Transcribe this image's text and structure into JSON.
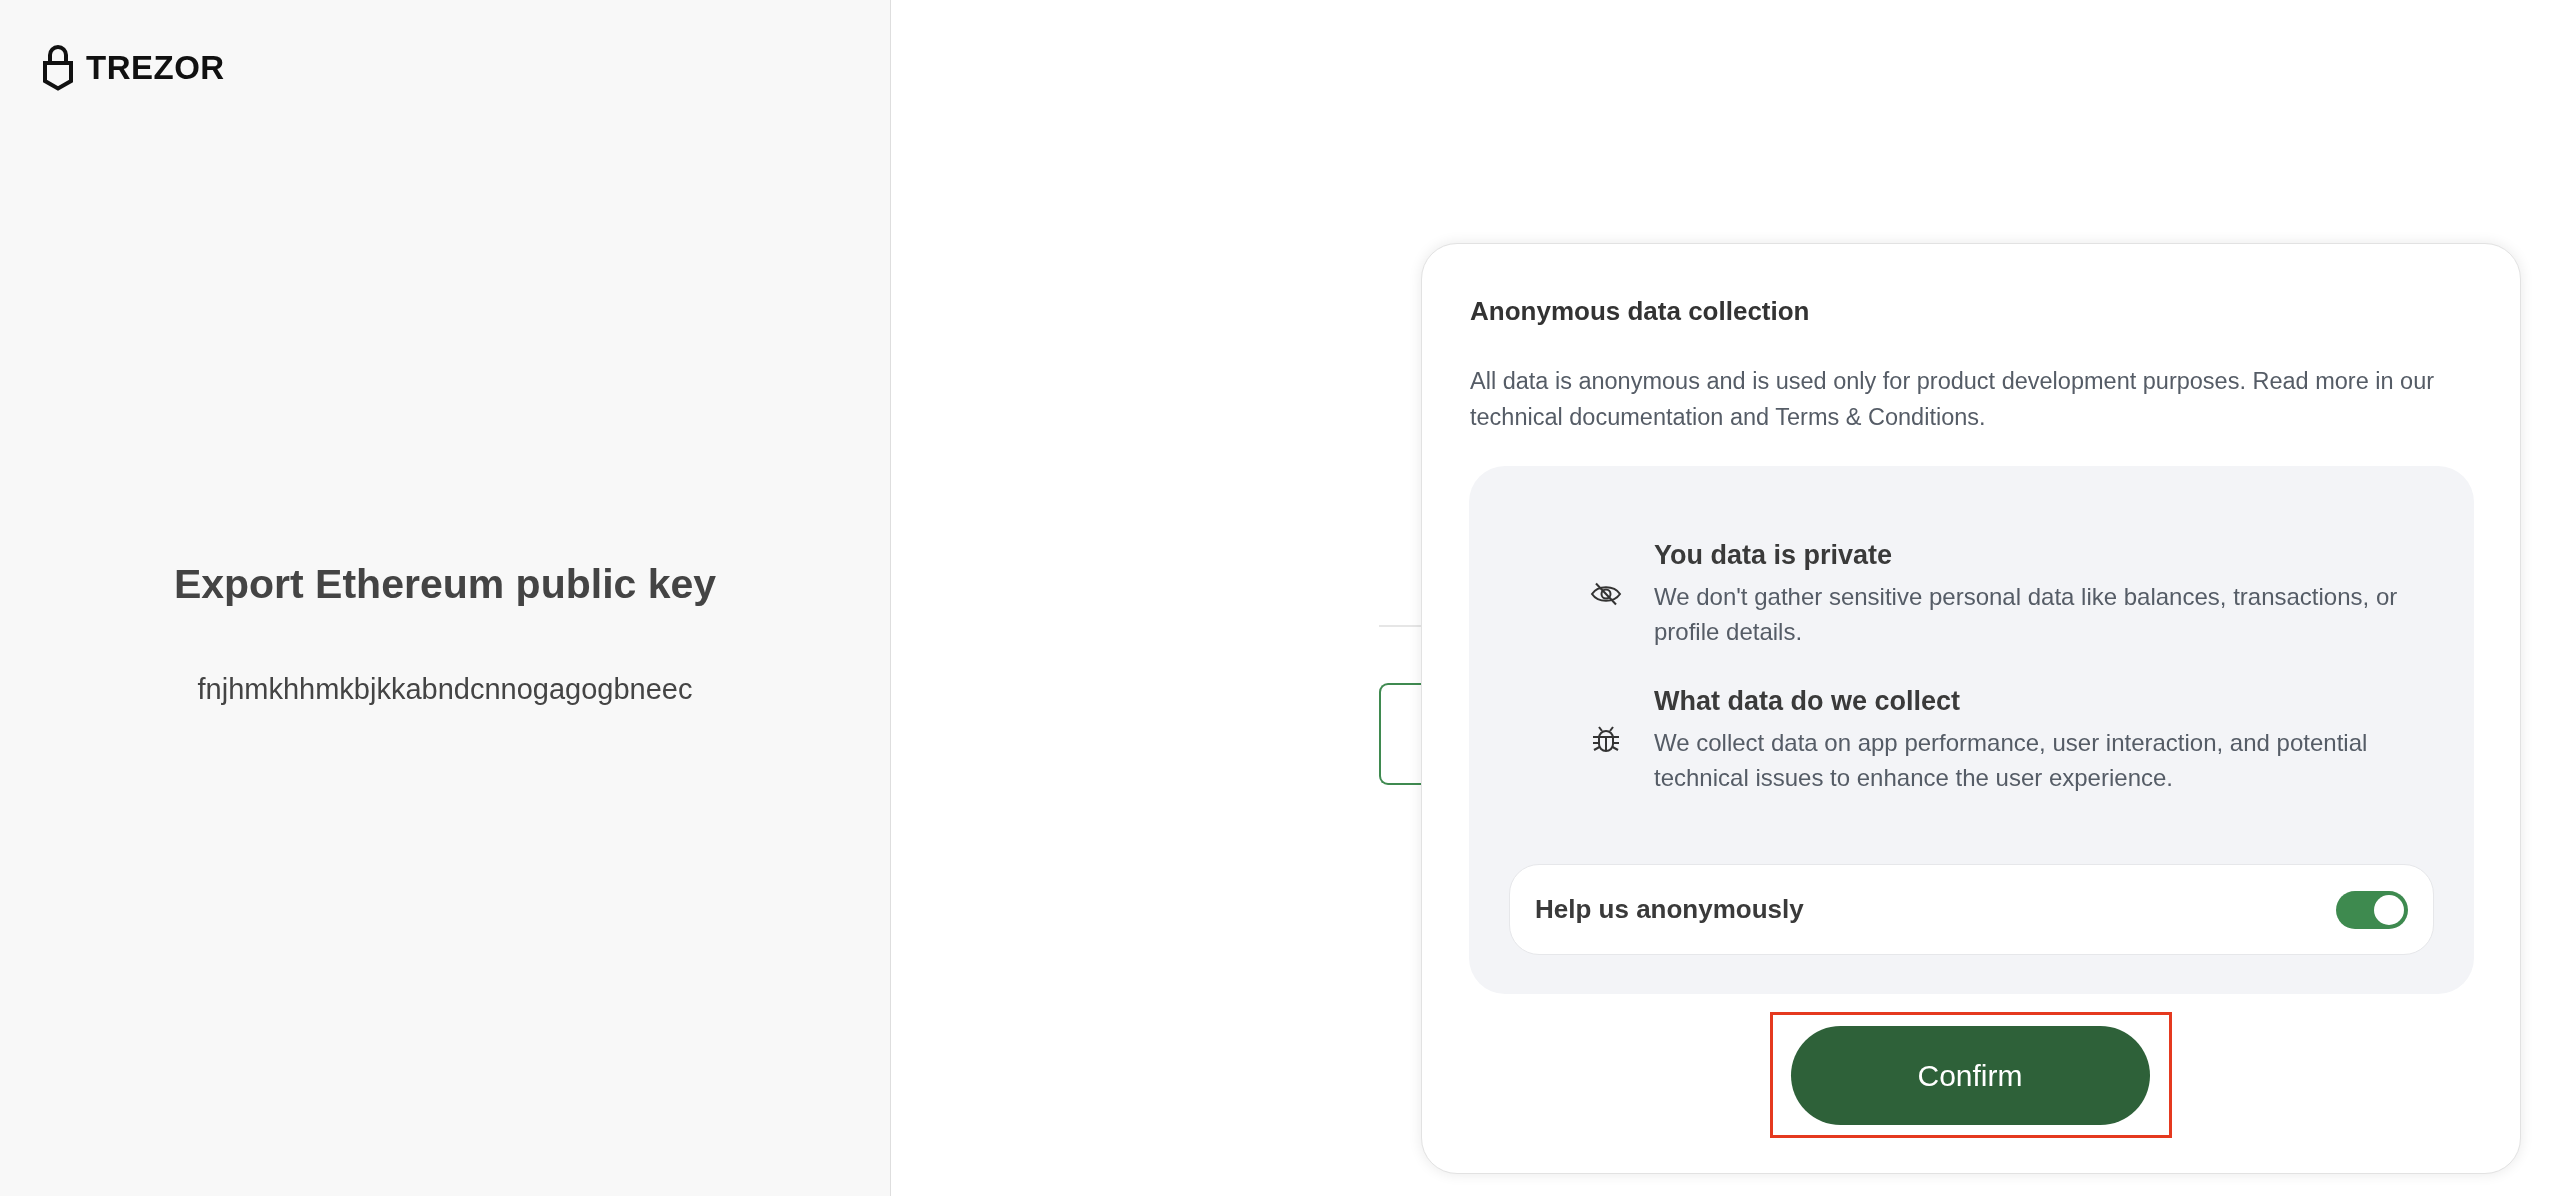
{
  "brand": {
    "name": "TREZOR"
  },
  "request": {
    "title": "Export Ethereum public key",
    "subtitle": "fnjhmkhhmkbjkkabndcnnogagogbneec"
  },
  "dialog": {
    "title": "Anonymous data collection",
    "description": "All data is anonymous and is used only for product development purposes. Read more in our technical documentation and Terms & Conditions.",
    "points": [
      {
        "title": "You data is private",
        "text": "We don't gather sensitive personal data like balances, transactions, or profile details."
      },
      {
        "title": "What data do we collect",
        "text": "We collect data on app performance, user interaction, and potential technical issues to enhance the user experience."
      }
    ],
    "toggle": {
      "label": "Help us anonymously",
      "on": true
    },
    "confirm_button": {
      "label": "Confirm",
      "highlighted": true
    }
  }
}
